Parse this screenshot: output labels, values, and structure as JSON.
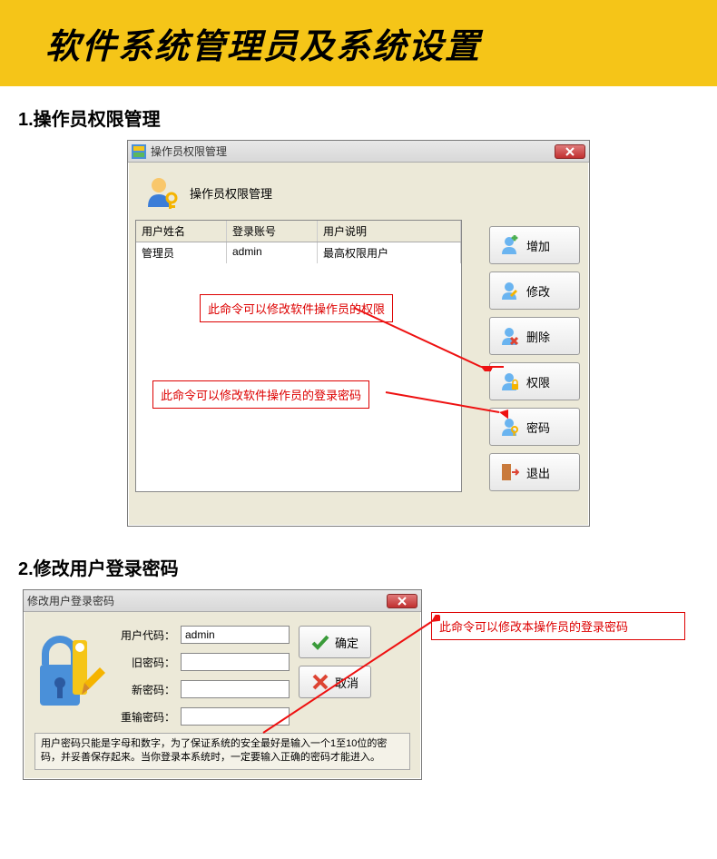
{
  "banner": {
    "title": "软件系统管理员及系统设置"
  },
  "section1": {
    "title": "1.操作员权限管理",
    "dialog": {
      "window_title": "操作员权限管理",
      "panel_title": "操作员权限管理",
      "columns": [
        "用户姓名",
        "登录账号",
        "用户说明"
      ],
      "rows": [
        {
          "name": "管理员",
          "account": "admin",
          "desc": "最高权限用户"
        }
      ],
      "buttons": {
        "add": "增加",
        "edit": "修改",
        "delete": "删除",
        "perm": "权限",
        "pwd": "密码",
        "exit": "退出"
      }
    },
    "annot1": "此命令可以修改软件操作员的权限",
    "annot2": "此命令可以修改软件操作员的登录密码"
  },
  "section2": {
    "title": "2.修改用户登录密码",
    "dialog": {
      "window_title": "修改用户登录密码",
      "labels": {
        "usercode": "用户代码：",
        "oldpwd": "旧密码：",
        "newpwd": "新密码：",
        "repwd": "重输密码："
      },
      "values": {
        "usercode": "admin"
      },
      "buttons": {
        "ok": "确定",
        "cancel": "取消"
      },
      "hint": "用户密码只能是字母和数字，为了保证系统的安全最好是输入一个1至10位的密码，并妥善保存起来。当你登录本系统时，一定要输入正确的密码才能进入。"
    },
    "annot": "此命令可以修改本操作员的登录密码"
  }
}
